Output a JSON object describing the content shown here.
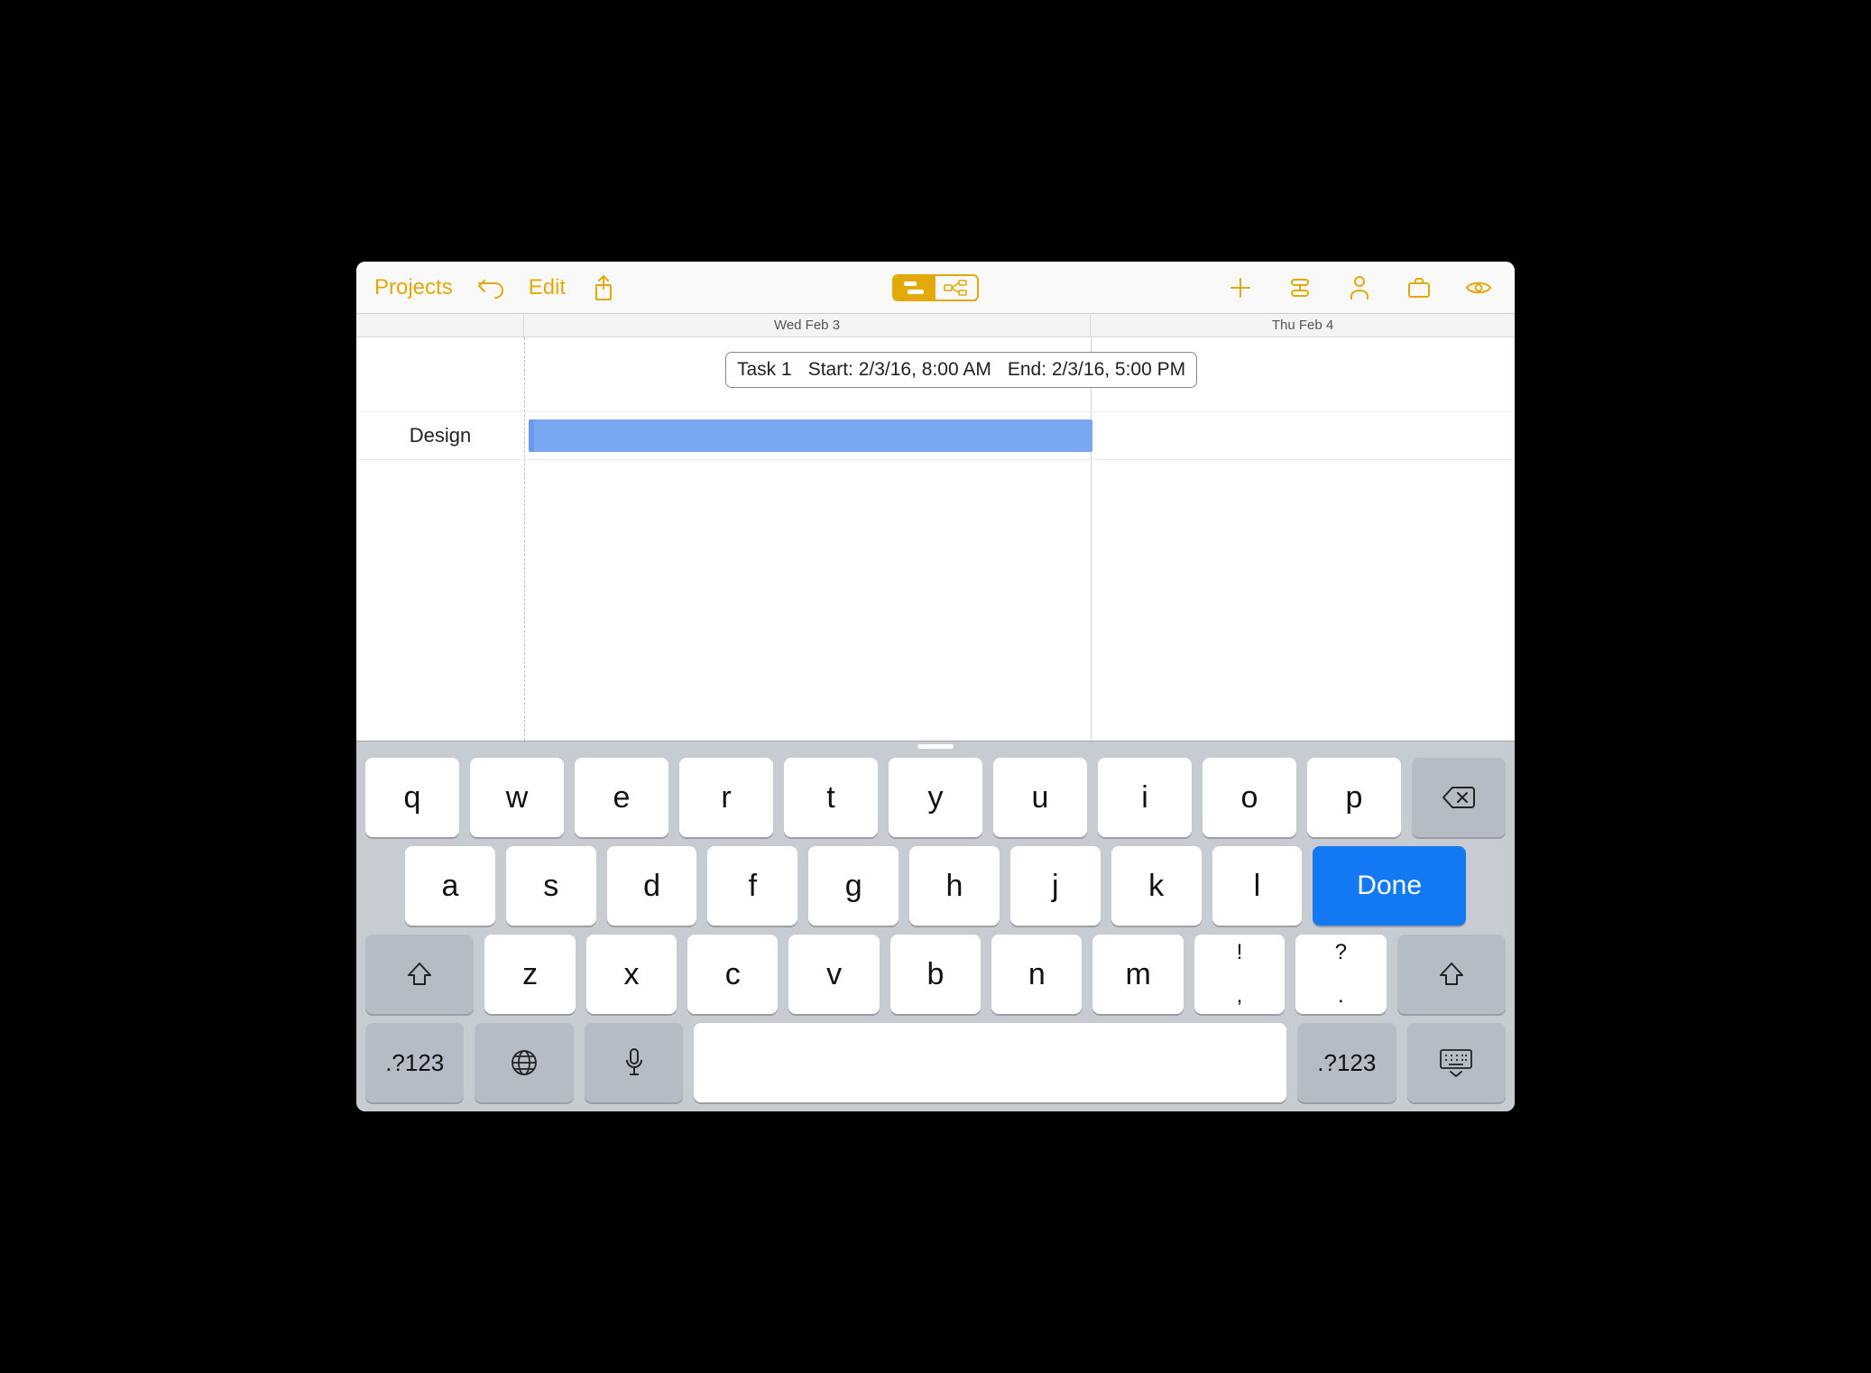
{
  "toolbar": {
    "projects": "Projects",
    "edit": "Edit"
  },
  "dates": {
    "day1": "Wed Feb 3",
    "day2": "Thu Feb 4"
  },
  "tooltip": {
    "task": "Task 1",
    "start": "Start: 2/3/16, 8:00 AM",
    "end": "End: 2/3/16, 5:00 PM"
  },
  "rows": [
    {
      "label": "Design"
    }
  ],
  "keyboard": {
    "row1": [
      "q",
      "w",
      "e",
      "r",
      "t",
      "y",
      "u",
      "i",
      "o",
      "p"
    ],
    "row2": [
      "a",
      "s",
      "d",
      "f",
      "g",
      "h",
      "j",
      "k",
      "l"
    ],
    "row3": [
      "z",
      "x",
      "c",
      "v",
      "b",
      "n",
      "m"
    ],
    "punct1_top": "!",
    "punct1_bot": ",",
    "punct2_top": "?",
    "punct2_bot": ".",
    "done": "Done",
    "numLabel": ".?123"
  }
}
